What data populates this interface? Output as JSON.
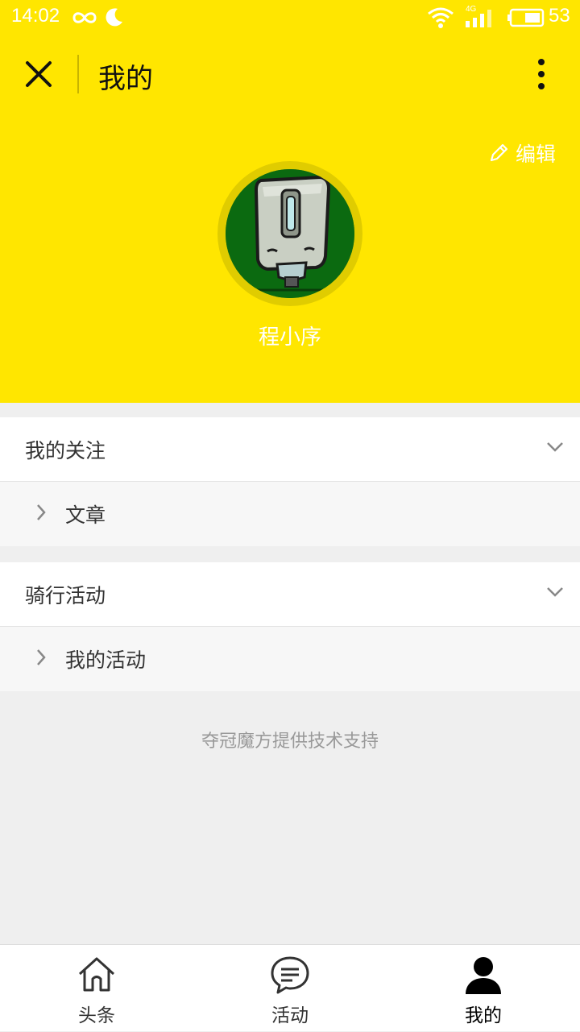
{
  "status_bar": {
    "time": "14:02",
    "network": "4G",
    "battery": "53"
  },
  "header": {
    "title": "我的",
    "edit_label": "编辑"
  },
  "profile": {
    "username": "程小序"
  },
  "sections": [
    {
      "title": "我的关注",
      "items": [
        {
          "label": "文章"
        }
      ]
    },
    {
      "title": "骑行活动",
      "items": [
        {
          "label": "我的活动"
        }
      ]
    }
  ],
  "footer": {
    "support_text": "夺冠魔方提供技术支持"
  },
  "tabbar": {
    "tabs": [
      {
        "label": "头条",
        "icon": "home-icon"
      },
      {
        "label": "活动",
        "icon": "chat-icon"
      },
      {
        "label": "我的",
        "icon": "user-icon",
        "active": true
      }
    ]
  },
  "colors": {
    "brand_yellow": "#ffe600",
    "avatar_green": "#0b6a10"
  }
}
